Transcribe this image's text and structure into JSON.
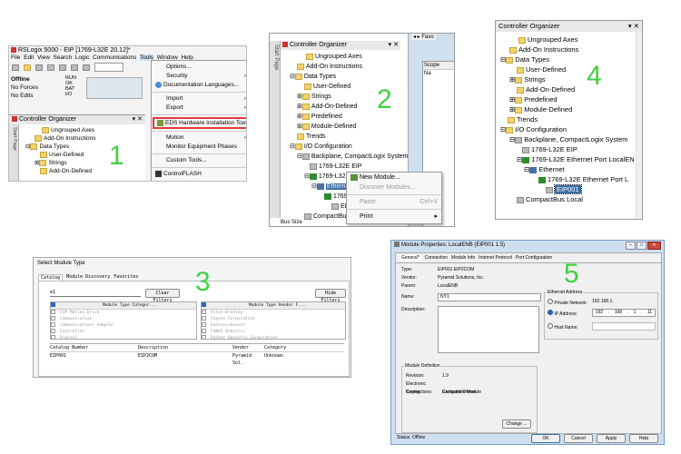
{
  "p1": {
    "title": "RSLogix 5000 - EIP [1769-L32E 20.12]*",
    "menubar": [
      "File",
      "Edit",
      "View",
      "Search",
      "Logic",
      "Communications",
      "Tools",
      "Window",
      "Help"
    ],
    "status": [
      "Offline",
      "No Forces",
      "No Edits"
    ],
    "indicators": [
      "RUN",
      "OK",
      "BAT",
      "I/O"
    ],
    "organizer_title": "Controller Organizer",
    "side_tab": "Start Page",
    "tree": [
      "Ungrouped Axes",
      "Add-On Instructions",
      "Data Types",
      "User-Defined",
      "Strings",
      "Add-On-Defined"
    ],
    "tools_menu": [
      "Options...",
      "Security",
      "Documentation Languages...",
      "Import",
      "Export",
      "EDS Hardware Installation Tool",
      "Motion",
      "Monitor Equipment Phases",
      "Custom Tools...",
      "ControlFLASH"
    ],
    "step": "1",
    "highlight_color": "#e23b3b"
  },
  "p2": {
    "title": "Controller Organizer",
    "side_tab": "Start Page",
    "tab_label": "Favo",
    "scope_label": "Scope",
    "na_label": "Na",
    "tree": [
      "Ungrouped Axes",
      "Add-On Instructions",
      "Data Types",
      "User-Defined",
      "Strings",
      "Add-On-Defined",
      "Predefined",
      "Module-Defined",
      "Trends",
      "I/O Configuration",
      "Backplane, CompactLogix System",
      "1769-L32E EIP",
      "1769-L32E Ethernet Port LocalEN",
      "Ethernet",
      "1769",
      "EIP",
      "CompactBus"
    ],
    "context_menu": [
      "New Module...",
      "Discover Modules...",
      "Paste",
      "Print"
    ],
    "paste_shortcut": "Ctrl+V",
    "footer": "Bus Size",
    "step": "2"
  },
  "p3": {
    "title": "Select Module Type",
    "tabs": [
      "Catalog",
      "Module Discovery",
      "Favorites"
    ],
    "search_value": "e1",
    "clear_filters": "Clear Filters",
    "hide_filters": "Hide Filters",
    "cat_header": "Module Type Categor...",
    "vendor_header": "Module Type Vendor F...",
    "categories": [
      "CIP Motion Drive",
      "Communication",
      "Communications Adapter",
      "Controller",
      "Digital"
    ],
    "vendors": [
      "Allen-Bradley",
      "Cognex Corporation",
      "Endress+Hauser",
      "FANUC Robotics",
      "Parker Hannifin Corporation"
    ],
    "columns": [
      "Catalog Number",
      "Description",
      "Vendor",
      "Category"
    ],
    "row": [
      "EIP001",
      "EIP2COM",
      "Pyramid Sol.",
      "Unknown"
    ],
    "step": "3"
  },
  "p4": {
    "title": "Controller Organizer",
    "tree": [
      "Ungrouped Axes",
      "Add-On Instructions",
      "Data Types",
      "User-Defined",
      "Strings",
      "Add-On-Defined",
      "Predefined",
      "Module-Defined",
      "Trends",
      "I/O Configuration",
      "Backplane, CompactLogix System",
      "1769-L32E EIP",
      "1769-L32E Ethernet Port LocalEN",
      "Ethernet",
      "1769-L32E Ethernet Port L",
      "EIP001",
      "CompactBus Local"
    ],
    "step": "4"
  },
  "p5": {
    "title": "Module Properties: LocalENB (EIP001 1.5)",
    "tabs": [
      "General*",
      "Connection",
      "Module Info",
      "Internet Protocol",
      "Port Configuration"
    ],
    "type_label": "Type:",
    "type_value": "EIP001 EIP2COM",
    "vendor_label": "Vendor:",
    "vendor_value": "Pyramid Solutions, Inc.",
    "parent_label": "Parent:",
    "parent_value": "LocalENB",
    "name_label": "Name:",
    "name_value": "NY1",
    "desc_label": "Description:",
    "eth_title": "Ethernet Address",
    "private_label": "Private Network:",
    "private_value": "192.168.1.",
    "ip_label": "IP Address:",
    "ip": [
      "192",
      "168",
      "1",
      "11"
    ],
    "host_label": "Host Name:",
    "def_title": "Module Definition",
    "rev_label": "Revision:",
    "rev_value": "1.9",
    "key_label": "Electronic Keying:",
    "key_value": "Compatible Module",
    "conn_label": "Connections:",
    "conn_value": "Exclusive Owner",
    "change_btn": "Change ...",
    "status_label": "Status:",
    "status_value": "Offline",
    "buttons": [
      "OK",
      "Cancel",
      "Apply",
      "Help"
    ],
    "step": "5"
  }
}
